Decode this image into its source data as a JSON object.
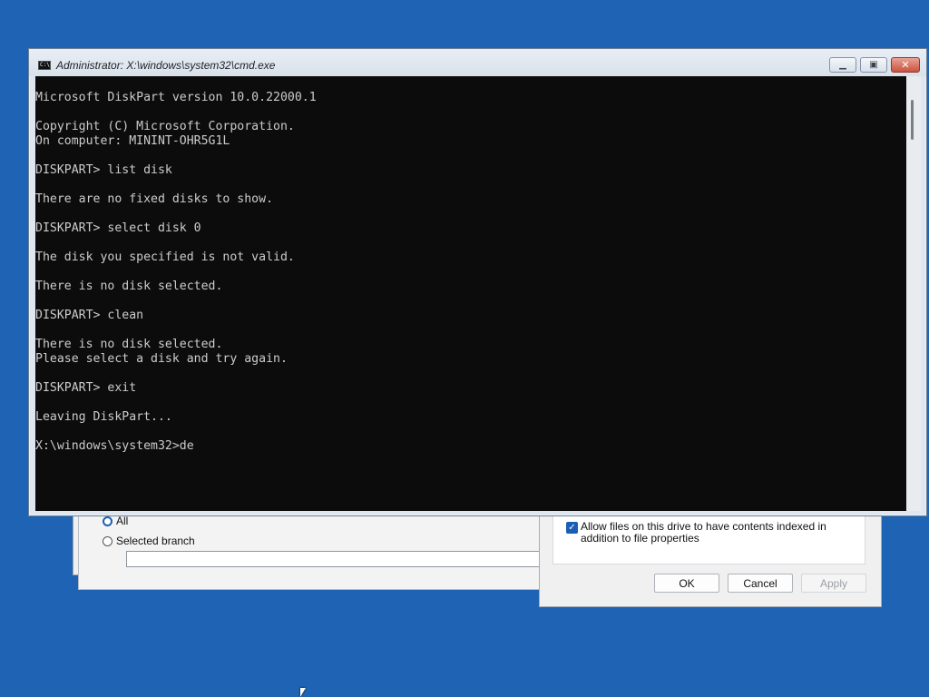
{
  "desktop": {
    "background_color": "#1f64b4"
  },
  "export_dialog": {
    "range_options": [
      {
        "label": "All",
        "selected": true
      },
      {
        "label": "Selected branch",
        "selected": false
      }
    ],
    "branch_value": ""
  },
  "properties_dialog": {
    "index_checkbox": {
      "label": "Allow files on this drive to have contents indexed in addition to file properties",
      "checked": true
    },
    "buttons": {
      "ok": "OK",
      "cancel": "Cancel",
      "apply": "Apply"
    },
    "apply_enabled": false
  },
  "cmd_window": {
    "title": "Administrator: X:\\windows\\system32\\cmd.exe",
    "icon": "cmd-icon",
    "controls": {
      "minimize": "minimize-icon",
      "maximize": "restore-icon",
      "close": "close-icon"
    },
    "lines": [
      "Microsoft DiskPart version 10.0.22000.1",
      "",
      "Copyright (C) Microsoft Corporation.",
      "On computer: MININT-OHR5G1L",
      "",
      "DISKPART> list disk",
      "",
      "There are no fixed disks to show.",
      "",
      "DISKPART> select disk 0",
      "",
      "The disk you specified is not valid.",
      "",
      "There is no disk selected.",
      "",
      "DISKPART> clean",
      "",
      "There is no disk selected.",
      "Please select a disk and try again.",
      "",
      "DISKPART> exit",
      "",
      "Leaving DiskPart...",
      "",
      "X:\\windows\\system32>de"
    ]
  }
}
